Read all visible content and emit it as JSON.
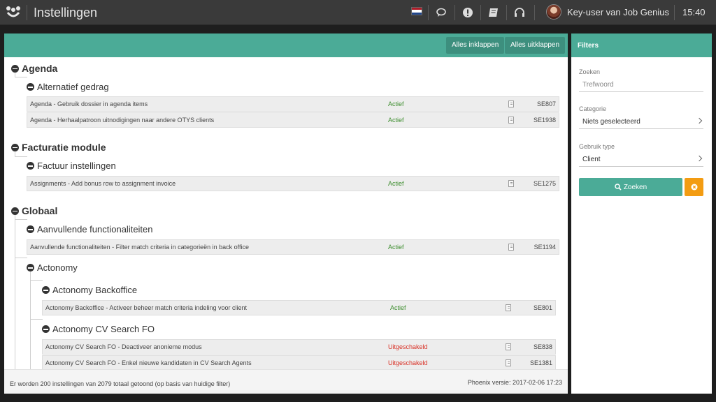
{
  "topbar": {
    "title": "Instellingen",
    "user_name": "Key-user van Job Genius",
    "time": "15:40",
    "icons": [
      "flag-nl-icon",
      "chat-icon",
      "alert-icon",
      "book-icon",
      "headset-icon"
    ]
  },
  "toolbar": {
    "collapse_all": "Alles inklappen",
    "expand_all": "Alles uitklappen"
  },
  "tree": {
    "agenda": {
      "label": "Agenda",
      "sub": {
        "label": "Alternatief gedrag",
        "rows": [
          {
            "name": "Agenda - Gebruik dossier in agenda items",
            "status": "Actief",
            "code": "SE807"
          },
          {
            "name": "Agenda - Herhaalpatroon uitnodigingen naar andere OTYS clients",
            "status": "Actief",
            "code": "SE1938"
          }
        ]
      }
    },
    "facturatie": {
      "label": "Facturatie module",
      "sub": {
        "label": "Factuur instellingen",
        "rows": [
          {
            "name": "Assignments - Add bonus row to assignment invoice",
            "status": "Actief",
            "code": "SE1275"
          }
        ]
      }
    },
    "globaal": {
      "label": "Globaal",
      "aanvullend": {
        "label": "Aanvullende functionaliteiten",
        "rows": [
          {
            "name": "Aanvullende functionaliteiten - Filter match criteria in categorieën in back office",
            "status": "Actief",
            "code": "SE1194"
          }
        ]
      },
      "actonomy": {
        "label": "Actonomy",
        "backoffice": {
          "label": "Actonomy Backoffice",
          "rows": [
            {
              "name": "Actonomy Backoffice - Activeer beheer match criteria indeling voor client",
              "status": "Actief",
              "code": "SE801"
            }
          ]
        },
        "cvsearch": {
          "label": "Actonomy CV Search FO",
          "rows": [
            {
              "name": "Actonomy CV Search FO - Deactiveer anonieme modus",
              "status": "Uitgeschakeld",
              "code": "SE838"
            },
            {
              "name": "Actonomy CV Search FO - Enkel nieuwe kandidaten in CV Search Agents",
              "status": "Uitgeschakeld",
              "code": "SE1381"
            }
          ]
        }
      }
    }
  },
  "footer": {
    "count_text": "Er worden 200 instellingen van 2079 totaal getoond (op basis van huidige filter)",
    "version_text": "Phoenix versie: 2017-02-06 17:23"
  },
  "filters": {
    "title": "Filters",
    "search_label": "Zoeken",
    "search_placeholder": "Trefwoord",
    "category_label": "Categorie",
    "category_value": "Niets geselecteerd",
    "usage_label": "Gebruik type",
    "usage_value": "Client",
    "search_button": "Zoeken"
  },
  "colors": {
    "accent": "#4bab97",
    "active": "#3e8e2f",
    "disabled": "#d93025",
    "reset": "#f39c12"
  }
}
